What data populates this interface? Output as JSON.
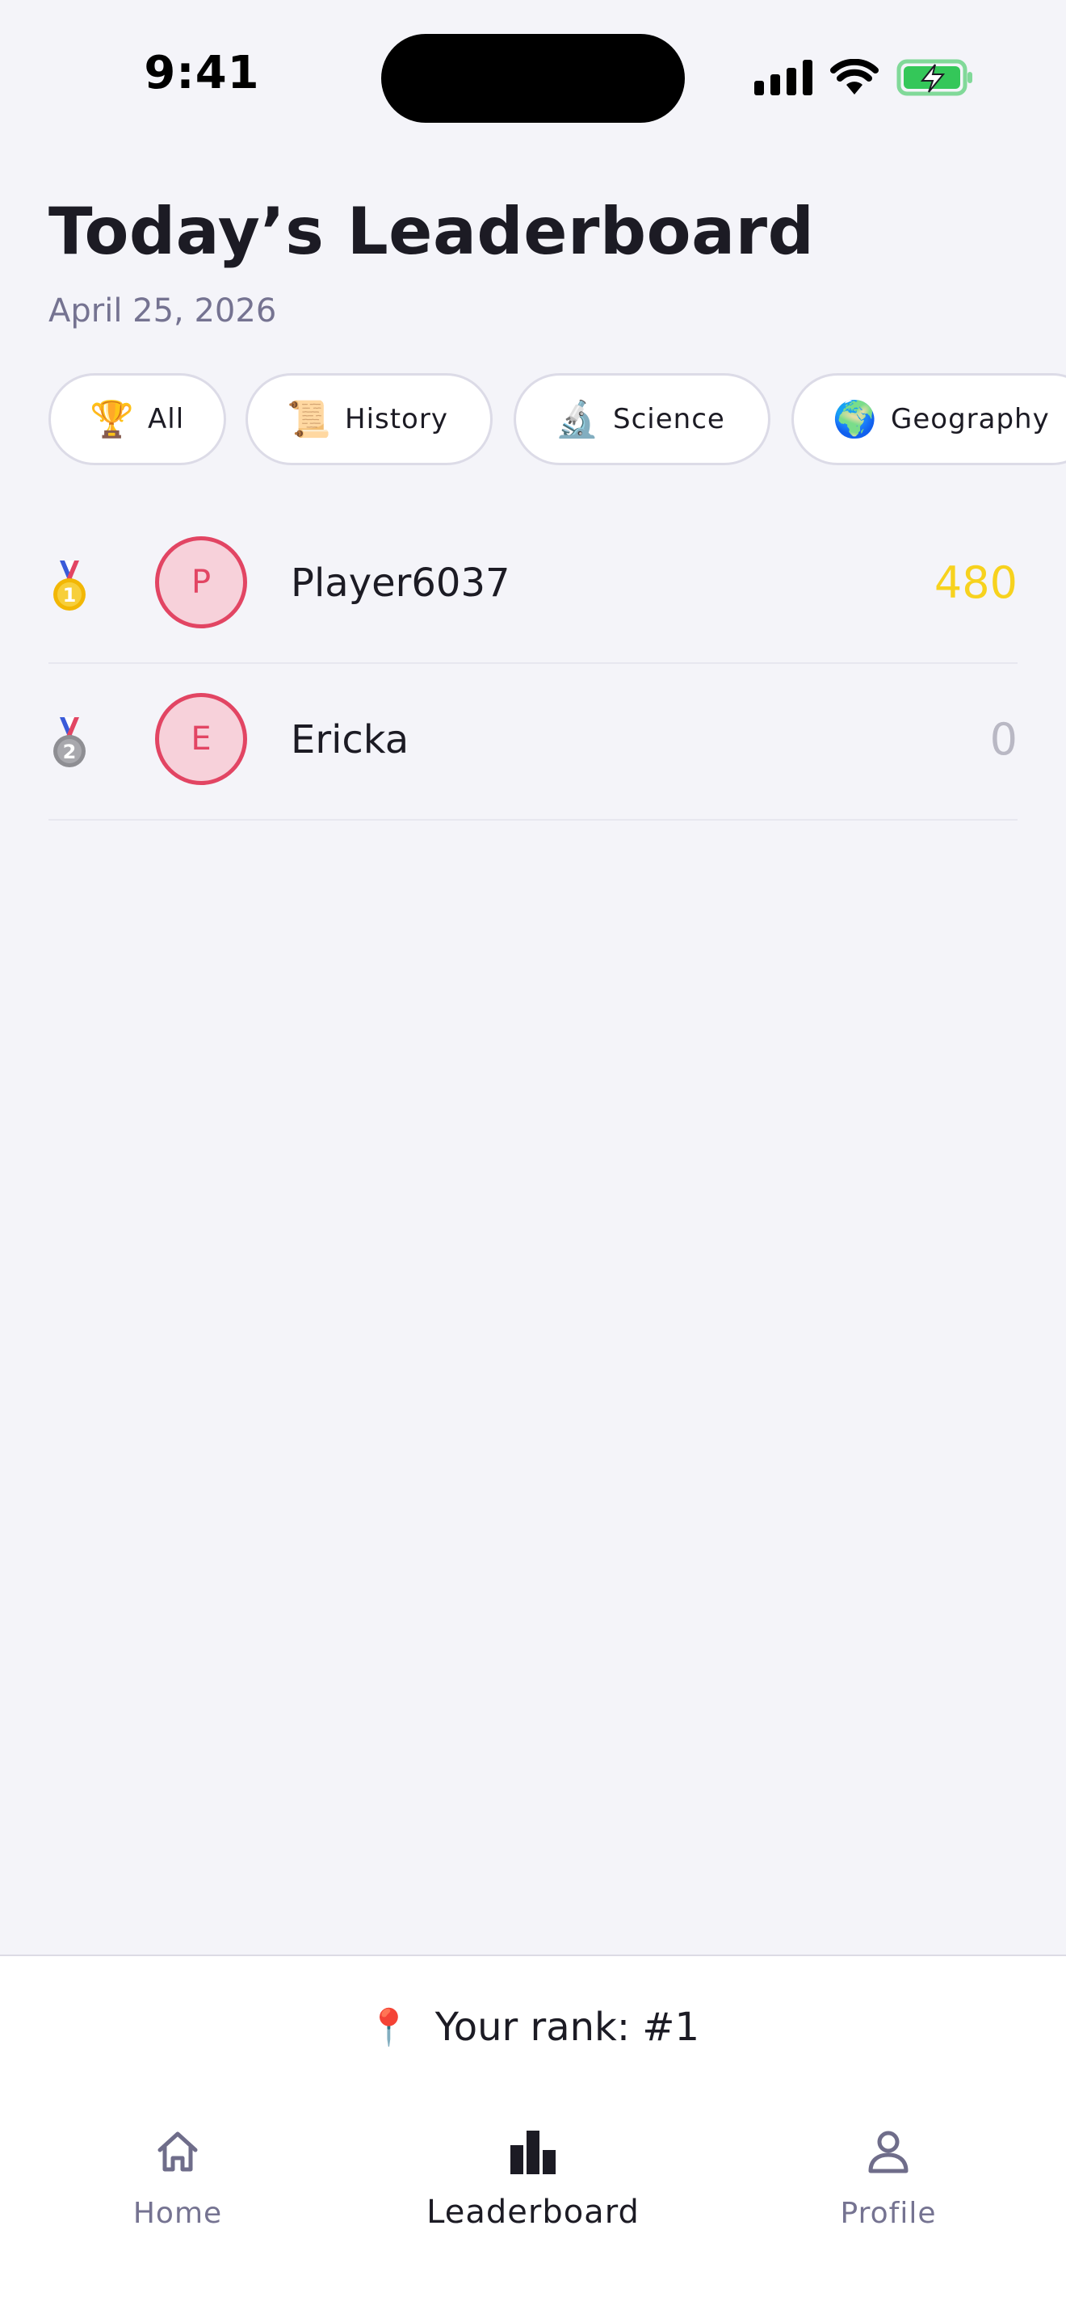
{
  "status_bar": {
    "time": "9:41",
    "icons": [
      "signal-icon",
      "wifi-icon",
      "battery-charging-icon"
    ],
    "battery_color": "#34c759"
  },
  "header": {
    "title": "Today’s Leaderboard",
    "date": "April 25, 2026"
  },
  "categories": [
    {
      "icon": "🏆",
      "icon_name": "trophy-icon",
      "label": "All"
    },
    {
      "icon": "📜",
      "icon_name": "scroll-icon",
      "label": "History"
    },
    {
      "icon": "🔬",
      "icon_name": "microscope-icon",
      "label": "Science"
    },
    {
      "icon": "🌍",
      "icon_name": "globe-icon",
      "label": "Geography"
    }
  ],
  "leaderboard": [
    {
      "rank_icon": "gold-medal-icon",
      "rank": 1,
      "initial": "P",
      "name": "Player6037",
      "score": "480",
      "score_color": "#f7d21e"
    },
    {
      "rank_icon": "silver-medal-icon",
      "rank": 2,
      "initial": "E",
      "name": "Ericka",
      "score": "0",
      "score_color": "#b9b8c4"
    }
  ],
  "avatar_colors": {
    "border": "#e24563",
    "fill": "#f7d1da"
  },
  "your_rank": {
    "icon": "📍",
    "icon_name": "pin-icon",
    "text": "Your rank: #1"
  },
  "tabs": [
    {
      "label": "Home",
      "icon_name": "home-icon",
      "active": false
    },
    {
      "label": "Leaderboard",
      "icon_name": "leaderboard-icon",
      "active": true
    },
    {
      "label": "Profile",
      "icon_name": "profile-icon",
      "active": false
    }
  ]
}
